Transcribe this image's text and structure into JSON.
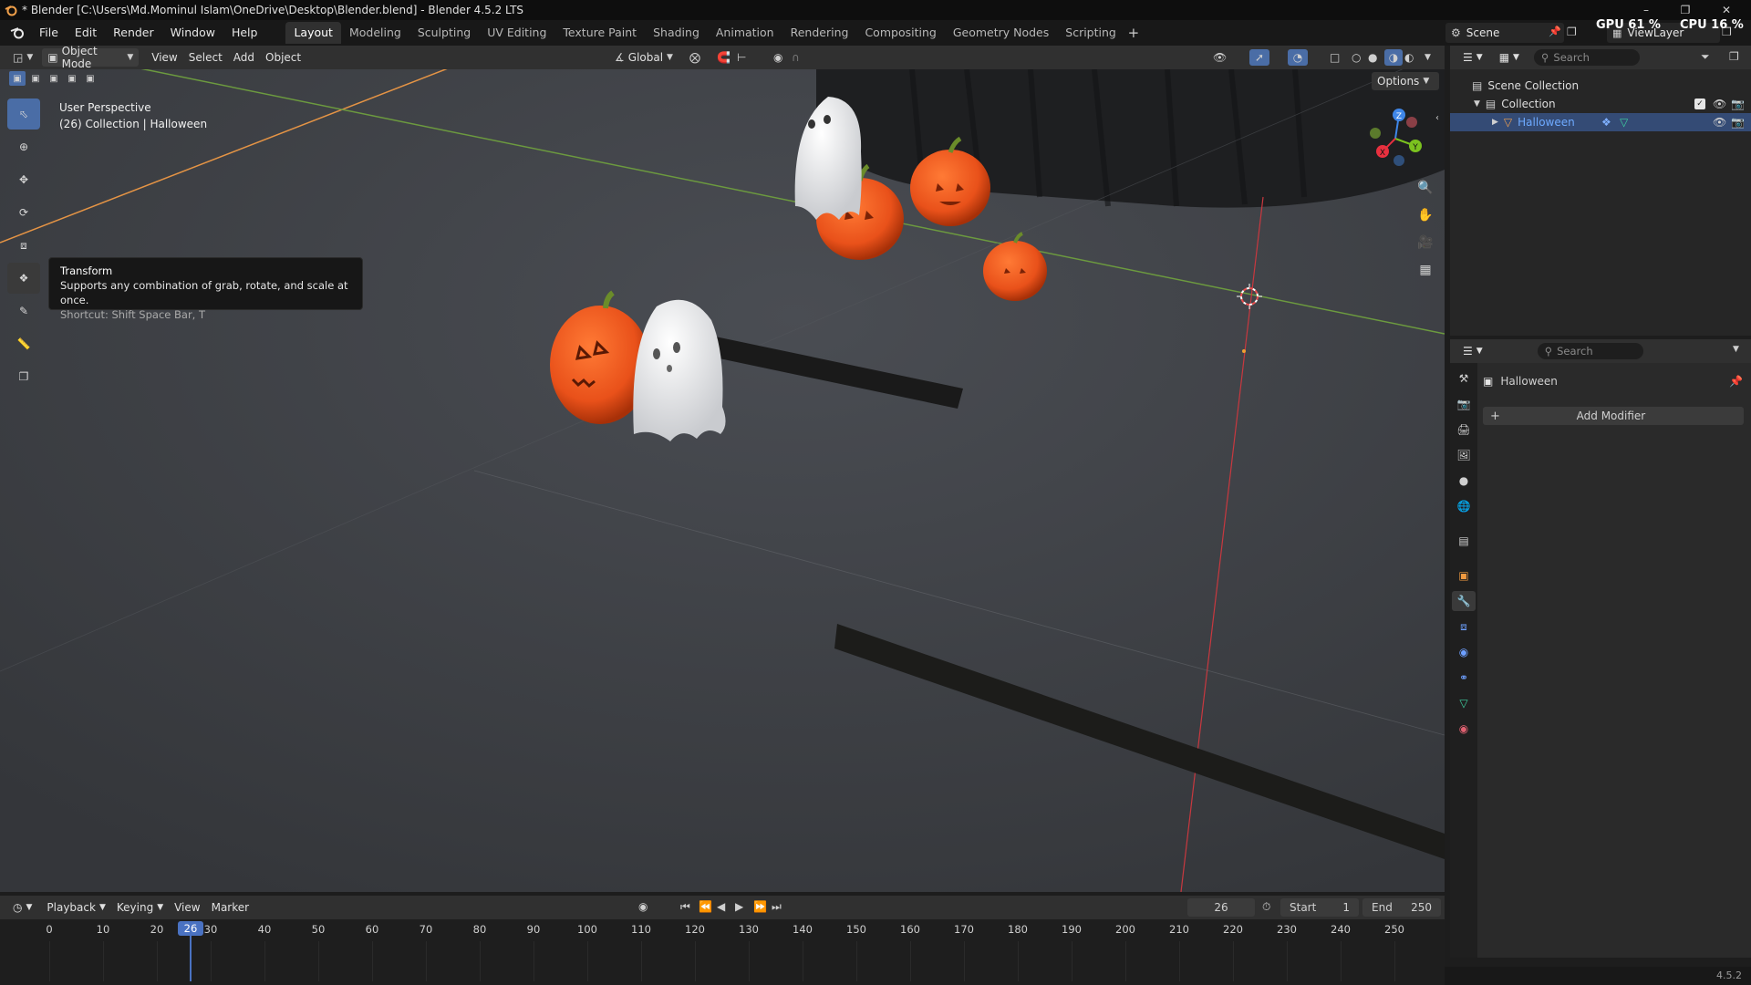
{
  "window": {
    "title": "* Blender [C:\\Users\\Md.Mominul Islam\\OneDrive\\Desktop\\Blender.blend] - Blender 4.5.2 LTS",
    "gpu": "GPU 61 %",
    "cpu": "CPU 16 %"
  },
  "menu": {
    "items": [
      "File",
      "Edit",
      "Render",
      "Window",
      "Help"
    ],
    "workspaces": [
      "Layout",
      "Modeling",
      "Sculpting",
      "UV Editing",
      "Texture Paint",
      "Shading",
      "Animation",
      "Rendering",
      "Compositing",
      "Geometry Nodes",
      "Scripting"
    ],
    "active_workspace": "Layout",
    "scene": "Scene",
    "view_layer": "ViewLayer"
  },
  "viewport": {
    "mode": "Object Mode",
    "menus": [
      "View",
      "Select",
      "Add",
      "Object"
    ],
    "orientation": "Global",
    "options_label": "Options",
    "overlay_line1": "User Perspective",
    "overlay_line2": "(26) Collection | Halloween",
    "gizmo_axes": {
      "x": "X",
      "y": "Y",
      "z": "Z"
    }
  },
  "tooltip": {
    "title": "Transform",
    "description": "Supports any combination of grab, rotate, and scale at once.",
    "shortcut": "Shortcut: Shift Space Bar, T"
  },
  "outliner": {
    "search_placeholder": "Search",
    "scene_collection": "Scene Collection",
    "collection": "Collection",
    "object": "Halloween"
  },
  "properties": {
    "search_placeholder": "Search",
    "object_name": "Halloween",
    "add_modifier": "Add Modifier"
  },
  "timeline": {
    "menus": [
      "Playback",
      "Keying",
      "View",
      "Marker"
    ],
    "current_frame": "26",
    "start_label": "Start",
    "start_value": "1",
    "end_label": "End",
    "end_value": "250",
    "ticks": [
      "0",
      "10",
      "20",
      "30",
      "40",
      "50",
      "60",
      "70",
      "80",
      "90",
      "100",
      "110",
      "120",
      "130",
      "140",
      "150",
      "160",
      "170",
      "180",
      "190",
      "200",
      "210",
      "220",
      "230",
      "240",
      "250"
    ]
  },
  "status": {
    "version": "4.5.2"
  },
  "colors": {
    "accent": "#4a6da6",
    "selected_row": "#344b75",
    "pumpkin": "#f05a1f",
    "x_axis": "#e8303f",
    "y_axis": "#7bc21f",
    "z_axis": "#3f86e8"
  }
}
